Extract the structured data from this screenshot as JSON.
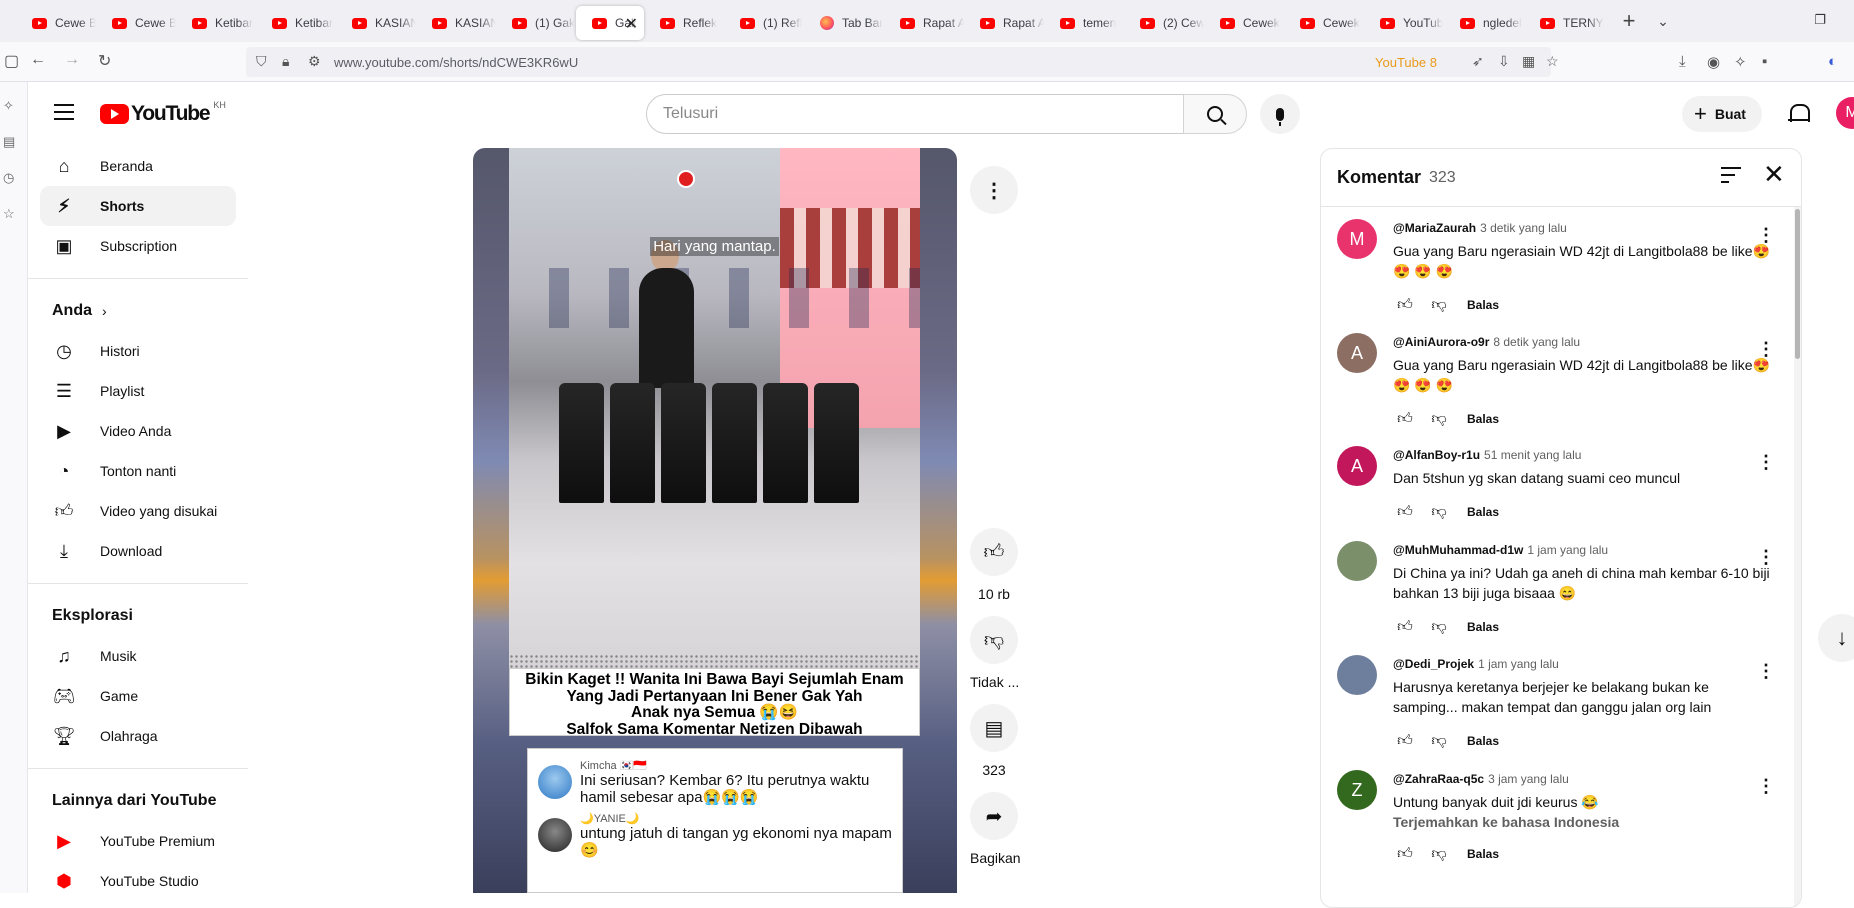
{
  "browser": {
    "tabs": [
      {
        "label": "Cewe B",
        "icon": "youtube-favicon"
      },
      {
        "label": "Cewe B",
        "icon": "youtube-favicon"
      },
      {
        "label": "Ketibar",
        "icon": "youtube-favicon"
      },
      {
        "label": "Ketibar",
        "icon": "youtube-favicon"
      },
      {
        "label": "KASIAN",
        "icon": "youtube-favicon"
      },
      {
        "label": "KASIAN",
        "icon": "youtube-favicon"
      },
      {
        "label": "(1) Gak",
        "icon": "youtube-favicon"
      },
      {
        "label": "Gak",
        "icon": "youtube-favicon",
        "active": true
      },
      {
        "label": "Reflek",
        "icon": "youtube-favicon"
      },
      {
        "label": "(1) Refl",
        "icon": "youtube-favicon"
      },
      {
        "label": "Tab Bar",
        "icon": "firefox-favicon"
      },
      {
        "label": "Rapat A",
        "icon": "youtube-favicon"
      },
      {
        "label": "Rapat A",
        "icon": "youtube-favicon"
      },
      {
        "label": "temen",
        "icon": "youtube-favicon"
      },
      {
        "label": "(2) Cew",
        "icon": "youtube-favicon"
      },
      {
        "label": "Cewek",
        "icon": "youtube-favicon"
      },
      {
        "label": "Cewek",
        "icon": "youtube-favicon"
      },
      {
        "label": "YouTub",
        "icon": "youtube-favicon"
      },
      {
        "label": "ngledel",
        "icon": "youtube-favicon"
      },
      {
        "label": "TERNYA",
        "icon": "youtube-favicon"
      }
    ],
    "url": "www.youtube.com/shorts/ndCWE3KR6wU",
    "extension_label": "YouTube 8"
  },
  "header": {
    "region": "KH",
    "search_placeholder": "Telusuri",
    "create_label": "Buat",
    "avatar_letter": "M"
  },
  "sidebar": {
    "main": [
      {
        "label": "Beranda",
        "icon": "home-icon"
      },
      {
        "label": "Shorts",
        "icon": "shorts-icon",
        "active": true
      },
      {
        "label": "Subscription",
        "icon": "subscriptions-icon"
      }
    ],
    "you_heading": "Anda",
    "you": [
      {
        "label": "Histori",
        "icon": "history-icon"
      },
      {
        "label": "Playlist",
        "icon": "playlist-icon"
      },
      {
        "label": "Video Anda",
        "icon": "your-videos-icon"
      },
      {
        "label": "Tonton nanti",
        "icon": "watch-later-icon"
      },
      {
        "label": "Video yang disukai",
        "icon": "liked-videos-icon"
      },
      {
        "label": "Download",
        "icon": "download-icon"
      }
    ],
    "explore_heading": "Eksplorasi",
    "explore": [
      {
        "label": "Musik",
        "icon": "music-icon"
      },
      {
        "label": "Game",
        "icon": "gaming-icon"
      },
      {
        "label": "Olahraga",
        "icon": "trophy-icon"
      }
    ],
    "more_heading": "Lainnya dari YouTube",
    "more": [
      {
        "label": "YouTube Premium",
        "icon": "youtube-premium-icon"
      },
      {
        "label": "YouTube Studio",
        "icon": "youtube-studio-icon"
      }
    ]
  },
  "video": {
    "overlay_caption": "Hari yang mantap.",
    "headline_lines": [
      "Bikin Kaget !! Wanita Ini Bawa Bayi Sejumlah Enam",
      "Yang Jadi Pertanyaan Ini Bener Gak Yah",
      "Anak nya Semua 😭😆",
      "Salfok Sama Komentar Netizen Dibawah"
    ],
    "embedded_comments": [
      {
        "name": "Kimcha 🇰🇷🇮🇩",
        "text": "Ini seriusan? Kembar 6? Itu perutnya waktu hamil sebesar apa😭😭😭"
      },
      {
        "name": "🌙YANIE🌙",
        "text": "untung jatuh di tangan yg ekonomi nya mapam😊"
      }
    ]
  },
  "actions": {
    "like_count": "10 rb",
    "dislike_label": "Tidak ...",
    "comment_count": "323",
    "share_label": "Bagikan"
  },
  "comments": {
    "title": "Komentar",
    "count": "323",
    "items": [
      {
        "author": "@MariaZaurah",
        "time": "3 detik yang lalu",
        "text": "Gua yang Baru ngerasiain WD 42jt di Langitbola88 be like😍 😍 😍 😍",
        "avatar_letter": "M",
        "avatar_color": "#e8336d",
        "reply": "Balas"
      },
      {
        "author": "@AiniAurora-o9r",
        "time": "8 detik yang lalu",
        "text": "Gua yang Baru ngerasiain WD 42jt di Langitbola88 be like😍 😍 😍 😍",
        "avatar_letter": "A",
        "avatar_color": "#8d6e63",
        "reply": "Balas"
      },
      {
        "author": "@AlfanBoy-r1u",
        "time": "51 menit yang lalu",
        "text": "Dan 5tshun yg skan datang suami ceo muncul",
        "avatar_letter": "A",
        "avatar_color": "#c2185b",
        "reply": "Balas"
      },
      {
        "author": "@MuhMuhammad-d1w",
        "time": "1 jam yang lalu",
        "text": "Di China ya ini? Udah ga aneh di china mah kembar 6-10 biji bahkan 13 biji juga bisaaa 😄",
        "avatar_letter": "",
        "avatar_color": "#7a8f6a",
        "reply": "Balas"
      },
      {
        "author": "@Dedi_Projek",
        "time": "1 jam yang lalu",
        "text": "Harusnya keretanya berjejer ke belakang bukan ke samping... makan tempat dan ganggu jalan org lain",
        "avatar_letter": "",
        "avatar_color": "#6d7f9c",
        "reply": "Balas"
      },
      {
        "author": "@ZahraRaa-q5c",
        "time": "3 jam yang lalu",
        "text": "Untung banyak duit jdi keurus 😂",
        "avatar_letter": "Z",
        "avatar_color": "#33691e",
        "translate": "Terjemahkan ke bahasa Indonesia",
        "reply": "Balas"
      }
    ]
  },
  "colors": {
    "brand_red": "#ff0000",
    "active_bg": "#f2f2f2"
  }
}
